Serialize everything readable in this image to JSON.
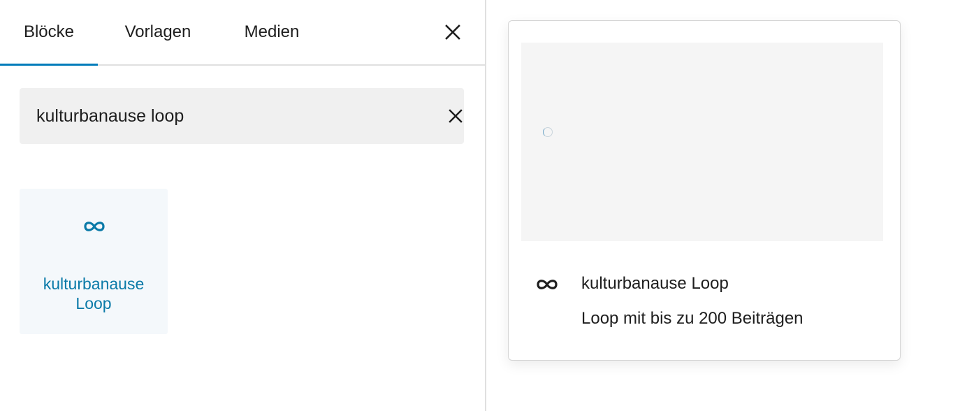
{
  "tabs": [
    {
      "label": "Blöcke",
      "active": true
    },
    {
      "label": "Vorlagen",
      "active": false
    },
    {
      "label": "Medien",
      "active": false
    }
  ],
  "close_icon": "close-icon",
  "search": {
    "value": "kulturbanause loop",
    "clear_icon": "close-icon"
  },
  "results": [
    {
      "label": "kulturbanause Loop",
      "icon": "loop-icon"
    }
  ],
  "preview": {
    "title": "kulturbanause Loop",
    "description": "Loop mit bis zu 200 Beiträgen",
    "icon": "loop-icon"
  },
  "colors": {
    "accent": "#007cba",
    "result_text": "#0a7aa8",
    "result_bg": "#f4f8fb",
    "search_bg": "#f0f0f0",
    "preview_canvas": "#f5f5f5"
  }
}
